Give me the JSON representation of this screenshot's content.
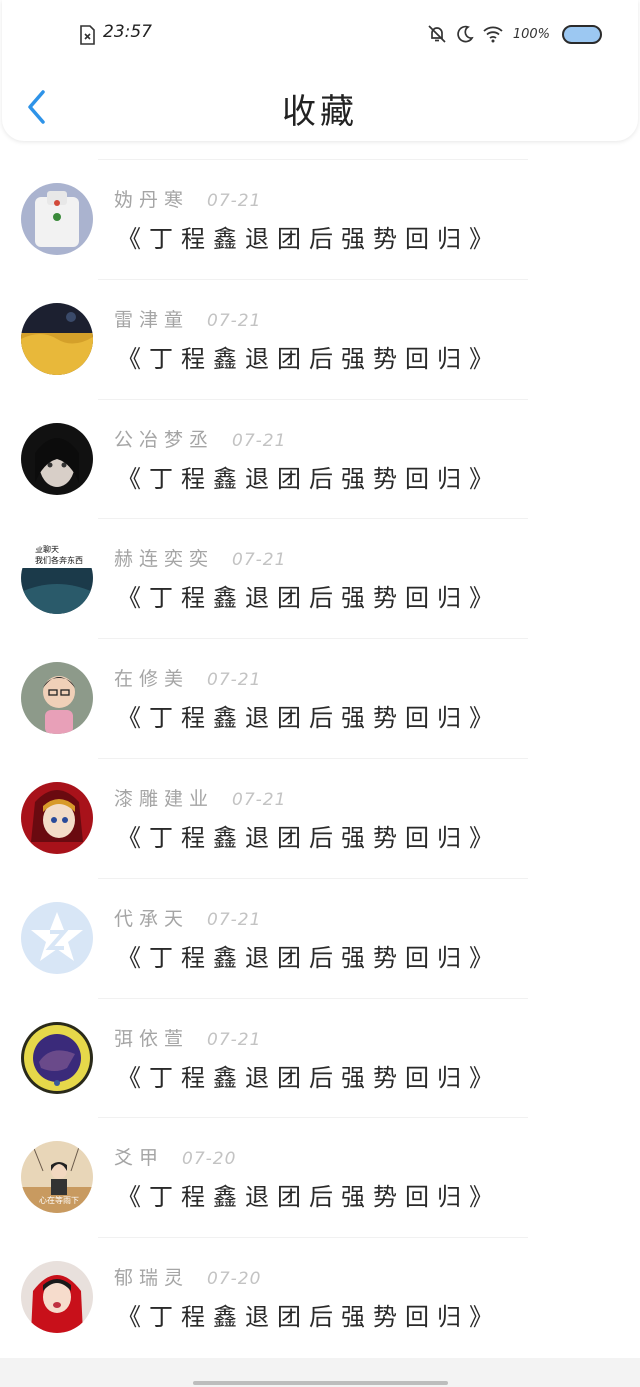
{
  "status_bar": {
    "time": "23:57",
    "battery_text": "100%",
    "icons": [
      "sim-error-icon",
      "mute-notification-icon",
      "moon-icon",
      "wifi-icon",
      "battery-icon"
    ]
  },
  "header": {
    "title": "收藏",
    "back_icon": "chevron-left-icon"
  },
  "favorites": [
    {
      "name": "妫丹寒",
      "date": "07-21",
      "title": "《丁程鑫退团后强势回归》"
    },
    {
      "name": "雷津童",
      "date": "07-21",
      "title": "《丁程鑫退团后强势回归》"
    },
    {
      "name": "公冶梦丞",
      "date": "07-21",
      "title": "《丁程鑫退团后强势回归》"
    },
    {
      "name": "赫连奕奕",
      "date": "07-21",
      "title": "《丁程鑫退团后强势回归》"
    },
    {
      "name": "在修美",
      "date": "07-21",
      "title": "《丁程鑫退团后强势回归》"
    },
    {
      "name": "漆雕建业",
      "date": "07-21",
      "title": "《丁程鑫退团后强势回归》"
    },
    {
      "name": "代承天",
      "date": "07-21",
      "title": "《丁程鑫退团后强势回归》"
    },
    {
      "name": "弭依萱",
      "date": "07-21",
      "title": "《丁程鑫退团后强势回归》"
    },
    {
      "name": "爻甲",
      "date": "07-20",
      "title": "《丁程鑫退团后强势回归》"
    },
    {
      "name": "郁瑞灵",
      "date": "07-20",
      "title": "《丁程鑫退团后强势回归》"
    }
  ],
  "avatar_texts": {
    "avatar_4_caption_line1": "业聊天",
    "avatar_4_caption_line2": "我们各奔东西",
    "avatar_9_caption": "心在等雨下"
  },
  "colors": {
    "accent": "#2e93e8",
    "name_text": "#a5a5a5",
    "date_text": "#c3c3c3",
    "title_text": "#2a2a2a",
    "battery_fill": "#9cc8f2"
  }
}
